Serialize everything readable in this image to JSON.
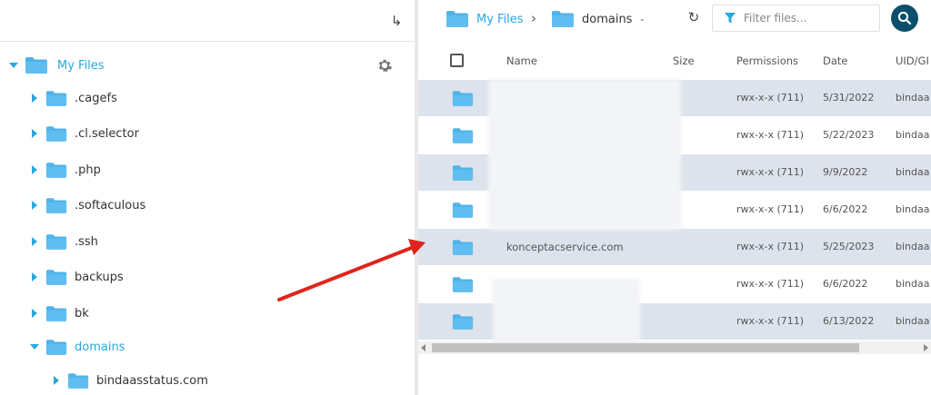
{
  "tree": {
    "root": {
      "label": "My Files"
    },
    "items": [
      {
        "label": ".cagefs",
        "expanded": false,
        "active": false
      },
      {
        "label": ".cl.selector",
        "expanded": false,
        "active": false
      },
      {
        "label": ".php",
        "expanded": false,
        "active": false
      },
      {
        "label": ".softaculous",
        "expanded": false,
        "active": false
      },
      {
        "label": ".ssh",
        "expanded": false,
        "active": false
      },
      {
        "label": "backups",
        "expanded": false,
        "active": false
      },
      {
        "label": "bk",
        "expanded": false,
        "active": false
      },
      {
        "label": "domains",
        "expanded": true,
        "active": true
      },
      {
        "label": "bindaasstatus.com",
        "expanded": false,
        "active": false
      }
    ]
  },
  "breadcrumb": {
    "root": "My Files",
    "current": "domains"
  },
  "filter": {
    "placeholder": "Filter files..."
  },
  "table": {
    "columns": {
      "name": "Name",
      "size": "Size",
      "permissions": "Permissions",
      "date": "Date",
      "uid": "UID/GI"
    },
    "rows": [
      {
        "name": "",
        "size": "",
        "permissions": "rwx-x-x (711)",
        "date": "5/31/2022",
        "uid": "bindaa"
      },
      {
        "name": "",
        "size": "",
        "permissions": "rwx-x-x (711)",
        "date": "5/22/2023",
        "uid": "bindaa"
      },
      {
        "name": "",
        "size": "",
        "permissions": "rwx-x-x (711)",
        "date": "9/9/2022",
        "uid": "bindaa"
      },
      {
        "name": "",
        "size": "",
        "permissions": "rwx-x-x (711)",
        "date": "6/6/2022",
        "uid": "bindaa"
      },
      {
        "name": "konceptacservice.com",
        "size": "",
        "permissions": "rwx-x-x (711)",
        "date": "5/25/2023",
        "uid": "bindaa"
      },
      {
        "name": "",
        "size": "",
        "permissions": "rwx-x-x (711)",
        "date": "6/6/2022",
        "uid": "bindaa"
      },
      {
        "name": "",
        "size": "",
        "permissions": "rwx-x-x (711)",
        "date": "6/13/2022",
        "uid": "bindaa"
      }
    ]
  },
  "colors": {
    "accent": "#2aa7e0",
    "folder": "#4fb3ea",
    "row_shade": "#dde3ec",
    "search_button": "#0b4f6c",
    "annotation_arrow": "#e0241b"
  },
  "icons": {
    "collapse": "return-arrow-icon",
    "settings": "gear-icon",
    "refresh": "refresh-icon",
    "filter": "funnel-icon",
    "search": "search-icon",
    "folder": "folder-icon"
  }
}
